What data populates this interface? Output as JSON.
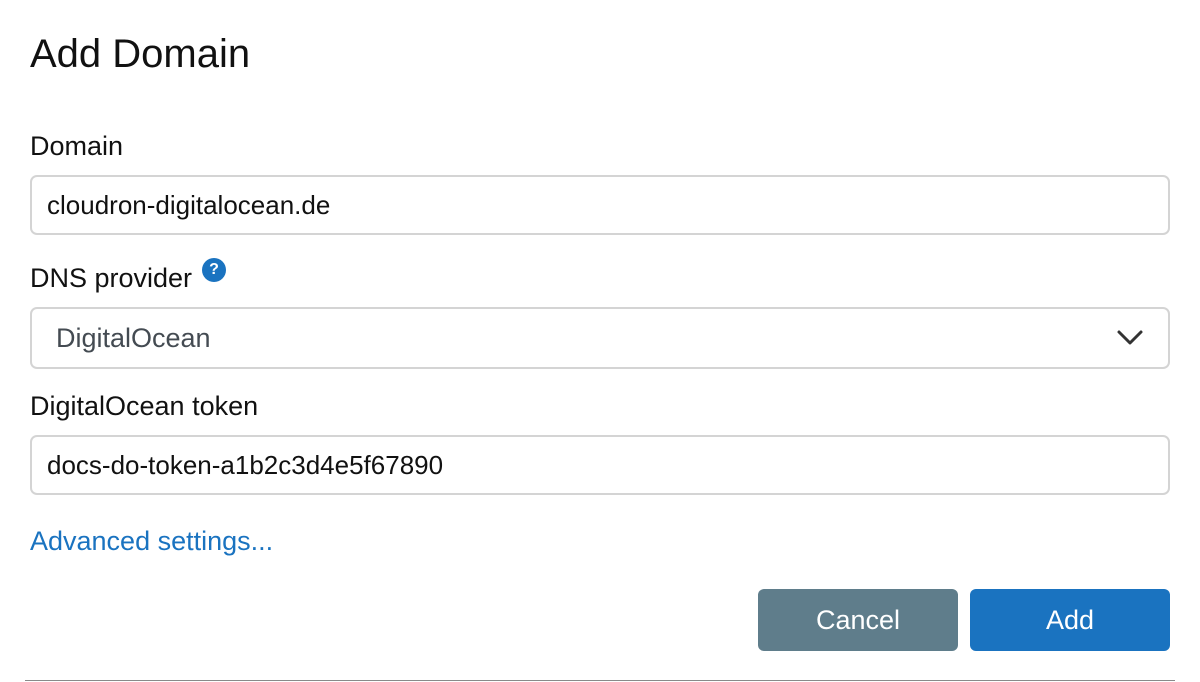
{
  "dialog": {
    "title": "Add Domain"
  },
  "domain_field": {
    "label": "Domain",
    "value": "cloudron-digitalocean.de"
  },
  "dns_provider": {
    "label": "DNS provider",
    "help_icon": "question-circle-icon",
    "help_glyph": "?",
    "selected": "DigitalOcean"
  },
  "token_field": {
    "label": "DigitalOcean token",
    "value": "docs-do-token-a1b2c3d4e5f67890"
  },
  "advanced_link": "Advanced settings...",
  "buttons": {
    "cancel_label": "Cancel",
    "add_label": "Add"
  },
  "colors": {
    "accent": "#1a73c0",
    "cancel": "#5f7d8b",
    "border": "#d4d4d4"
  }
}
